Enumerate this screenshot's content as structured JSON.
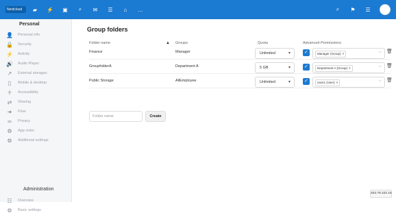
{
  "topbar": {
    "logo_text": "Nextcloud",
    "app_icons": [
      "files-icon",
      "activity-icon",
      "gallery-icon",
      "search-icon",
      "mail-icon",
      "contacts-icon",
      "home-icon",
      "more-icon"
    ],
    "right_icons": [
      "search-icon",
      "notifications-icon",
      "contacts-icon"
    ]
  },
  "sidebar": {
    "personal_title": "Personal",
    "items": [
      {
        "label": "Personal info",
        "icon": "user-icon"
      },
      {
        "label": "Security",
        "icon": "lock-icon"
      },
      {
        "label": "Activity",
        "icon": "bolt-icon"
      },
      {
        "label": "Audio Player",
        "icon": "audio-icon"
      },
      {
        "label": "External storages",
        "icon": "external-icon"
      },
      {
        "label": "Mobile & desktop",
        "icon": "phone-icon"
      },
      {
        "label": "Accessibility",
        "icon": "accessibility-icon"
      },
      {
        "label": "Sharing",
        "icon": "share-icon"
      },
      {
        "label": "Flow",
        "icon": "flow-icon"
      },
      {
        "label": "Privacy",
        "icon": "privacy-icon"
      },
      {
        "label": "App order",
        "icon": "settings-icon"
      },
      {
        "label": "Additional settings",
        "icon": "settings-icon"
      }
    ],
    "admin_title": "Administration",
    "admin_items": [
      {
        "label": "Overview",
        "icon": "overview-icon"
      },
      {
        "label": "Basic settings",
        "icon": "settings-icon"
      }
    ]
  },
  "main": {
    "title": "Group folders",
    "columns": {
      "folder_name": "Folder name",
      "groups": "Groups",
      "quota": "Quota",
      "advanced_permissions": "Advanced Permissions"
    },
    "rows": [
      {
        "folder": "Finance",
        "groups": "Manager",
        "quota": "Unlimited",
        "permission_tag": "Manager (Group)"
      },
      {
        "folder": "GroupfolderA",
        "groups": "Department A",
        "quota": "5 GB",
        "permission_tag": "Department A (Group)"
      },
      {
        "folder": "Public Storage",
        "groups": "AllEmployee",
        "quota": "Unlimited",
        "permission_tag": "User1 (User)"
      }
    ],
    "new_folder": {
      "placeholder": "Folder name",
      "button": "Create"
    }
  },
  "tooltip": "203.79.102.16"
}
